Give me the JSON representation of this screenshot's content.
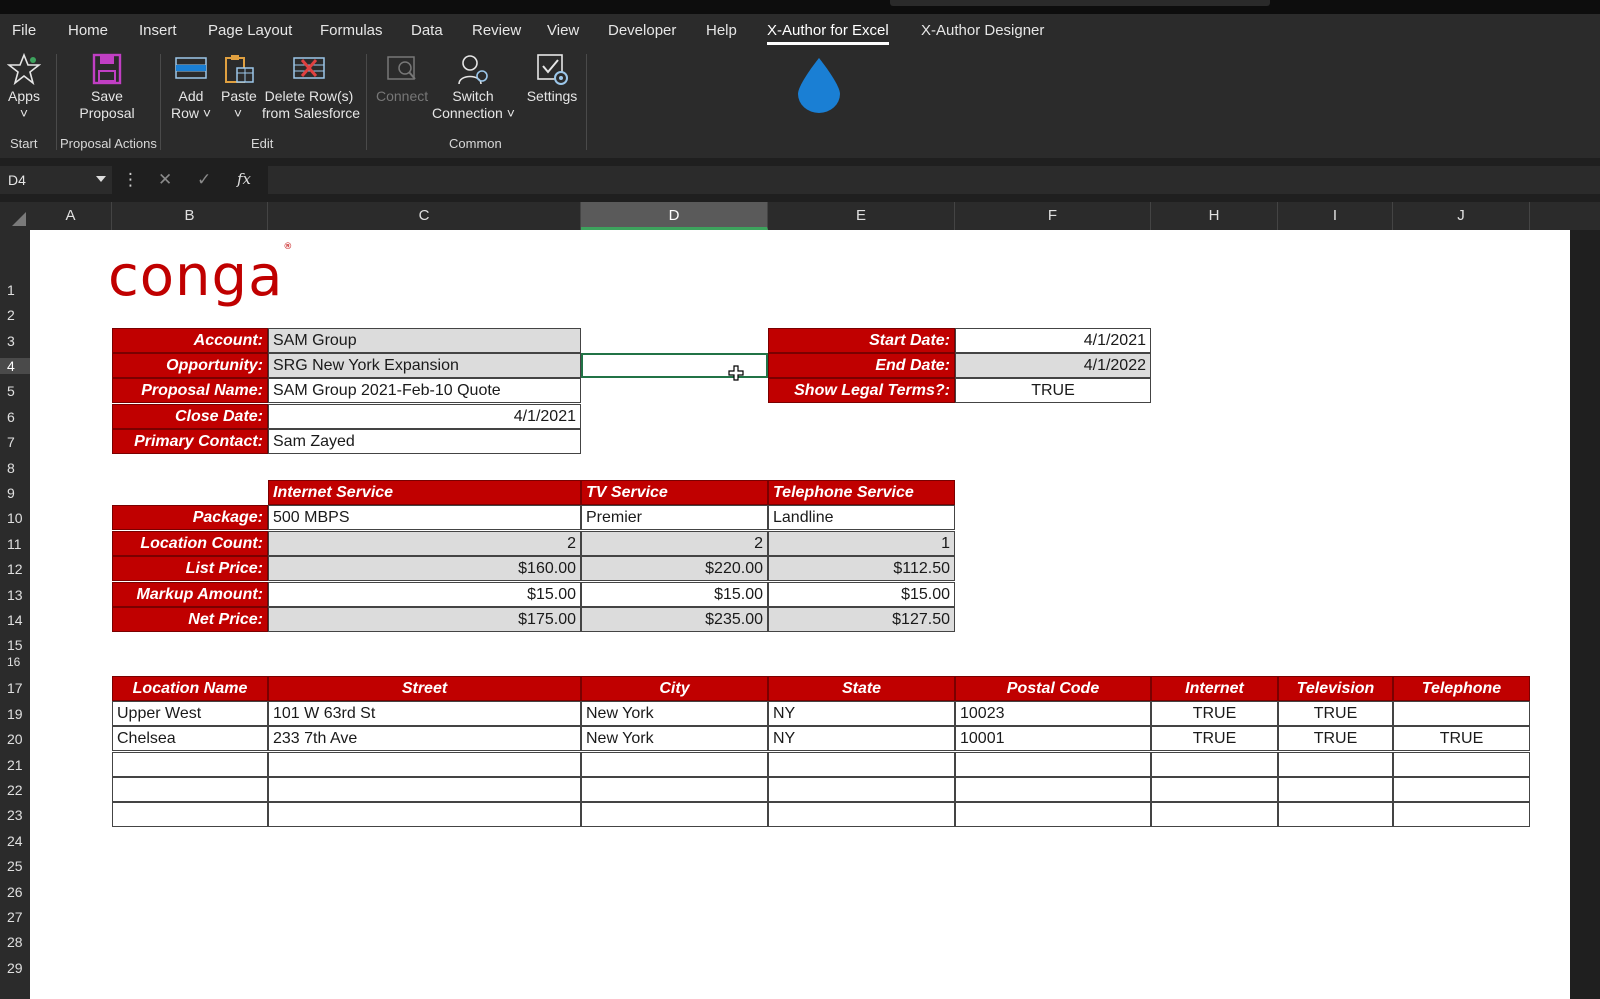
{
  "menu": {
    "tabs": [
      "File",
      "Home",
      "Insert",
      "Page Layout",
      "Formulas",
      "Data",
      "Review",
      "View",
      "Developer",
      "Help",
      "X-Author for Excel",
      "X-Author Designer"
    ],
    "active_tab": "X-Author for Excel"
  },
  "ribbon": {
    "apps": {
      "label": "Apps",
      "icon": "star-icon"
    },
    "save_proposal": {
      "label1": "Save",
      "label2": "Proposal",
      "icon": "save-icon"
    },
    "add_row": {
      "label1": "Add",
      "label2": "Row ˅",
      "icon": "add-row-icon"
    },
    "paste": {
      "label1": "Paste",
      "label2": "˅",
      "icon": "paste-icon"
    },
    "delete_rows": {
      "label1": "Delete Row(s)",
      "label2": "from Salesforce",
      "icon": "delete-rows-icon"
    },
    "connect": {
      "label1": "Connect",
      "icon": "connect-icon"
    },
    "switch_connection": {
      "label1": "Switch",
      "label2": "Connection ˅",
      "icon": "switch-connection-icon"
    },
    "settings": {
      "label1": "Settings",
      "icon": "settings-icon"
    },
    "apps_caret": "˅",
    "groups": {
      "start": "Start",
      "proposal_actions": "Proposal Actions",
      "edit": "Edit",
      "common": "Common"
    },
    "accent_color": "#1a7fd4"
  },
  "formula_bar": {
    "name_box": "D4",
    "fx": "fx",
    "cancel": "✕",
    "enter": "✓",
    "more": "⋮",
    "value": ""
  },
  "columns": [
    "A",
    "B",
    "C",
    "D",
    "E",
    "F",
    "H",
    "I",
    "J"
  ],
  "selected_column": "D",
  "rows": [
    "1",
    "2",
    "3",
    "4",
    "5",
    "6",
    "7",
    "8",
    "9",
    "10",
    "11",
    "12",
    "13",
    "14",
    "15",
    "16",
    "17",
    "19",
    "20",
    "21",
    "22",
    "23",
    "24",
    "25",
    "26",
    "27",
    "28",
    "29"
  ],
  "selected_row": "4",
  "sheet": {
    "logo": "conga",
    "logo_mark": "®",
    "brand_color": "#c00000",
    "proposal": {
      "account_label": "Account:",
      "account": "SAM Group",
      "opportunity_label": "Opportunity:",
      "opportunity": "SRG New York Expansion",
      "proposal_name_label": "Proposal Name:",
      "proposal_name": "SAM Group 2021-Feb-10 Quote",
      "close_date_label": "Close Date:",
      "close_date": "4/1/2021",
      "primary_contact_label": "Primary Contact:",
      "primary_contact": "Sam Zayed"
    },
    "dates": {
      "start_label": "Start Date:",
      "start": "4/1/2021",
      "end_label": "End Date:",
      "end": "4/1/2022",
      "legal_label": "Show Legal Terms?:",
      "legal": "TRUE"
    },
    "services": {
      "headers": [
        "Internet Service",
        "TV Service",
        "Telephone Service"
      ],
      "rows": [
        {
          "label": "Package:",
          "values": [
            "500 MBPS",
            "Premier",
            "Landline"
          ]
        },
        {
          "label": "Location Count:",
          "values": [
            "2",
            "2",
            "1"
          ]
        },
        {
          "label": "List Price:",
          "values": [
            "$160.00",
            "$220.00",
            "$112.50"
          ]
        },
        {
          "label": "Markup Amount:",
          "values": [
            "$15.00",
            "$15.00",
            "$15.00"
          ]
        },
        {
          "label": "Net Price:",
          "values": [
            "$175.00",
            "$235.00",
            "$127.50"
          ]
        }
      ]
    },
    "locations": {
      "headers": [
        "Location Name",
        "Street",
        "City",
        "State",
        "Postal Code",
        "Internet",
        "Television",
        "Telephone"
      ],
      "rows": [
        [
          "Upper West",
          "101 W 63rd St",
          "New York",
          "NY",
          "10023",
          "TRUE",
          "TRUE",
          ""
        ],
        [
          "Chelsea",
          "233 7th Ave",
          "New York",
          "NY",
          "10001",
          "TRUE",
          "TRUE",
          "TRUE"
        ]
      ]
    }
  }
}
